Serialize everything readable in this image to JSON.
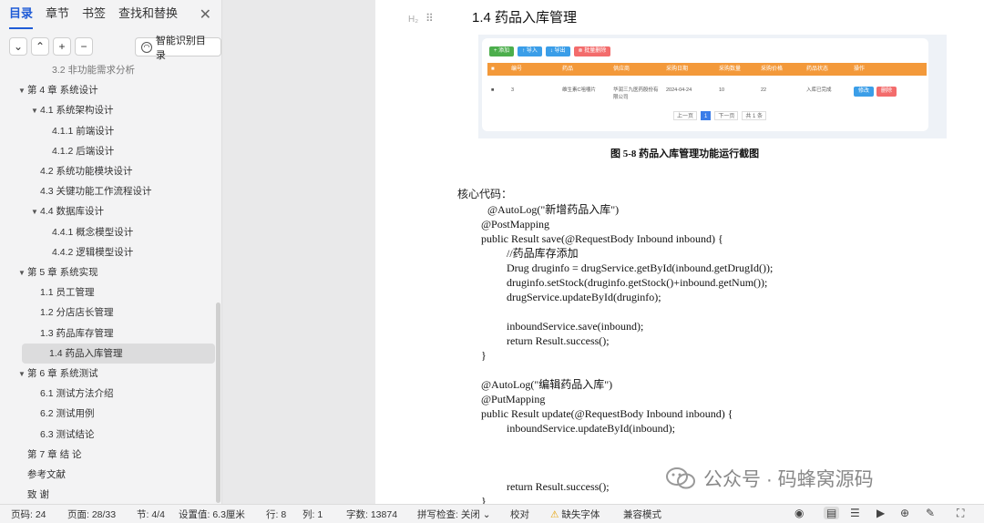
{
  "sidebar": {
    "tabs": [
      "目录",
      "章节",
      "书签",
      "查找和替换"
    ],
    "smart_toc_label": "智能识别目录",
    "toc": [
      {
        "level": 3,
        "label": "3.2  非功能需求分析",
        "arrow": ""
      },
      {
        "level": 1,
        "label": "第 4 章  系统设计",
        "arrow": "▼"
      },
      {
        "level": 2,
        "label": "4.1  系统架构设计",
        "arrow": "▼"
      },
      {
        "level": 3,
        "label": "4.1.1  前端设计",
        "arrow": ""
      },
      {
        "level": 3,
        "label": "4.1.2  后端设计",
        "arrow": ""
      },
      {
        "level": 2,
        "label": "4.2  系统功能模块设计",
        "arrow": ""
      },
      {
        "level": 2,
        "label": "4.3  关键功能工作流程设计",
        "arrow": ""
      },
      {
        "level": 2,
        "label": "4.4  数据库设计",
        "arrow": "▼"
      },
      {
        "level": 3,
        "label": "4.4.1  概念模型设计",
        "arrow": ""
      },
      {
        "level": 3,
        "label": "4.4.2  逻辑模型设计",
        "arrow": ""
      },
      {
        "level": 1,
        "label": "第 5 章  系统实现",
        "arrow": "▼"
      },
      {
        "level": 2,
        "label": "1.1  员工管理",
        "arrow": ""
      },
      {
        "level": 2,
        "label": "1.2  分店店长管理",
        "arrow": ""
      },
      {
        "level": 2,
        "label": "1.3  药品库存管理",
        "arrow": ""
      },
      {
        "level": 2,
        "label": "1.4  药品入库管理",
        "arrow": "",
        "active": true
      },
      {
        "level": 1,
        "label": "第 6 章  系统测试",
        "arrow": "▼"
      },
      {
        "level": 2,
        "label": "6.1  测试方法介绍",
        "arrow": ""
      },
      {
        "level": 2,
        "label": "6.2  测试用例",
        "arrow": ""
      },
      {
        "level": 2,
        "label": "6.3  测试结论",
        "arrow": ""
      },
      {
        "level": 1,
        "label": "第 7 章   结     论",
        "arrow": ""
      },
      {
        "level": 1,
        "label": "参考文献",
        "arrow": ""
      },
      {
        "level": 1,
        "label": "致     谢",
        "arrow": ""
      }
    ]
  },
  "doc": {
    "heading_mark": "H₂",
    "section_title": "1.4   药品入库管理",
    "screenshot": {
      "buttons": [
        {
          "label": "+ 添加",
          "color": "#4cae4c"
        },
        {
          "label": "↑ 导入",
          "color": "#3b9ee8"
        },
        {
          "label": "↓ 导出",
          "color": "#3b9ee8"
        },
        {
          "label": "⊗ 批量删除",
          "color": "#f36c6c"
        }
      ],
      "headers": [
        "■",
        "编号",
        "药品",
        "供应商",
        "采购日期",
        "采购数量",
        "采购价格",
        "药品状态",
        "操作"
      ],
      "row": [
        "■",
        "3",
        "维生素C咀嚼片",
        "华润三九医药股份有限公司",
        "2024-04-24",
        "10",
        "22",
        "入库已完成",
        ""
      ],
      "row_actions": [
        {
          "label": "修改",
          "color": "#3b9ee8"
        },
        {
          "label": "删除",
          "color": "#f36c6c"
        }
      ],
      "pager": [
        "上一页",
        "1",
        "下一页",
        "共 1 条"
      ]
    },
    "figure_caption": "图 5-8 药品入库管理功能运行截图",
    "code_label": "核心代码：",
    "code_lines": [
      {
        "indent": 0,
        "text": "@AutoLog(\"新增药品入库\")"
      },
      {
        "indent": 1,
        "text": "@PostMapping"
      },
      {
        "indent": 1,
        "text": "public Result save(@RequestBody Inbound inbound) {"
      },
      {
        "indent": 2,
        "text": "//药品库存添加"
      },
      {
        "indent": 2,
        "text": "Drug druginfo = drugService.getById(inbound.getDrugId());"
      },
      {
        "indent": 2,
        "text": "druginfo.setStock(druginfo.getStock()+inbound.getNum());"
      },
      {
        "indent": 2,
        "text": "drugService.updateById(druginfo);"
      },
      {
        "indent": 2,
        "text": ""
      },
      {
        "indent": 2,
        "text": "inboundService.save(inbound);"
      },
      {
        "indent": 2,
        "text": "return Result.success();"
      },
      {
        "indent": 1,
        "text": "}"
      },
      {
        "indent": 1,
        "text": ""
      },
      {
        "indent": 1,
        "text": "@AutoLog(\"编辑药品入库\")"
      },
      {
        "indent": 1,
        "text": "@PutMapping"
      },
      {
        "indent": 1,
        "text": "public Result update(@RequestBody Inbound inbound) {"
      },
      {
        "indent": 2,
        "text": "inboundService.updateById(inbound);"
      },
      {
        "indent": 2,
        "text": ""
      },
      {
        "indent": 2,
        "text": ""
      },
      {
        "indent": 2,
        "text": ""
      },
      {
        "indent": 2,
        "text": "return Result.success();"
      },
      {
        "indent": 1,
        "text": "}"
      }
    ],
    "watermark": "公众号 · 码蜂窝源码"
  },
  "status": {
    "page_code": "页码: 24",
    "page": "页面: 28/33",
    "section": "节: 4/4",
    "setting": "设置值: 6.3厘米",
    "row": "行: 8",
    "col": "列: 1",
    "words": "字数: 13874",
    "spell": "拼写检查: 关闭",
    "proof": "校对",
    "missing_font": "缺失字体",
    "compat": "兼容模式"
  }
}
